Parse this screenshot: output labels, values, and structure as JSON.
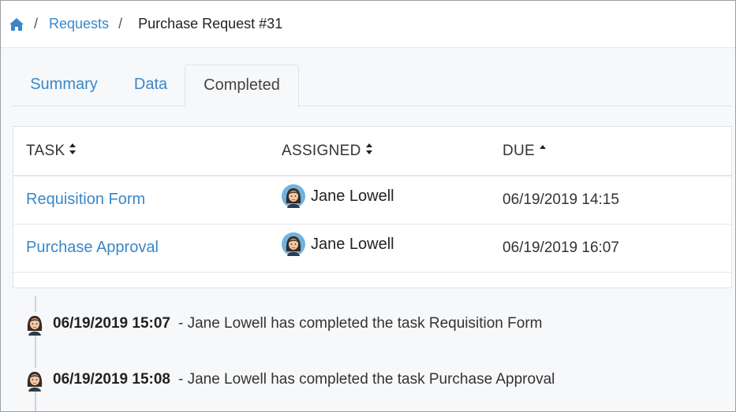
{
  "breadcrumb": {
    "home_icon": "home-icon",
    "separator": "/",
    "requests": "Requests",
    "current": "Purchase Request #31"
  },
  "tabs": [
    {
      "label": "Summary",
      "active": false
    },
    {
      "label": "Data",
      "active": false
    },
    {
      "label": "Completed",
      "active": true
    }
  ],
  "table": {
    "columns": [
      {
        "label": "TASK",
        "sort_icon": "sort-icon"
      },
      {
        "label": "ASSIGNED",
        "sort_icon": "sort-icon"
      },
      {
        "label": "DUE",
        "sort_icon": "sort-ascending-icon"
      }
    ],
    "rows": [
      {
        "task": "Requisition Form",
        "assigned": "Jane Lowell",
        "due": "06/19/2019 14:15"
      },
      {
        "task": "Purchase Approval",
        "assigned": "Jane Lowell",
        "due": "06/19/2019 16:07"
      }
    ]
  },
  "timeline": [
    {
      "timestamp": "06/19/2019 15:07",
      "message": "- Jane Lowell has completed the task Requisition Form"
    },
    {
      "timestamp": "06/19/2019 15:08",
      "message": "- Jane Lowell has completed the task Purchase Approval"
    }
  ],
  "colors": {
    "link": "#3a87c7",
    "border": "#dfe3e8",
    "background": "#f7f8fa"
  }
}
